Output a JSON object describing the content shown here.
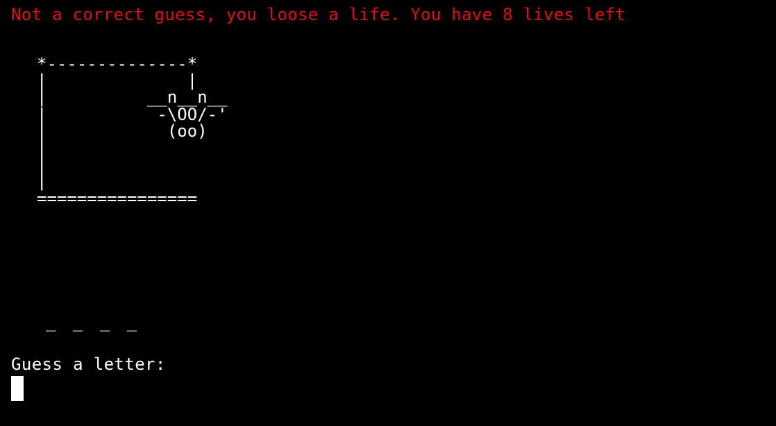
{
  "terminal": {
    "message": "Not a correct guess, you loose a life. You have 8 lives left",
    "hangman_art": "*--------------*\n|              |\n|          __n__n__\n|           -\\OO/-'\n|            (oo)\n|\n|\n|\n================",
    "word_progress": "_ _ _ _",
    "prompt": "Guess a letter:"
  },
  "colors": {
    "background": "#000000",
    "text": "#ffffff",
    "error": "#dd1111"
  }
}
